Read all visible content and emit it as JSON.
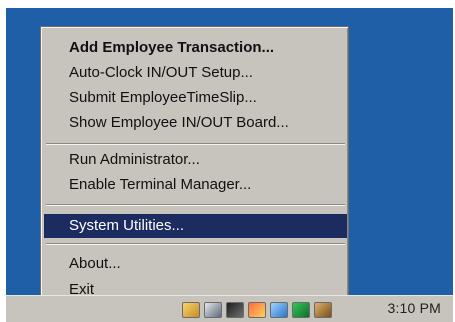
{
  "menu": {
    "items": [
      {
        "label": "Add Employee Transaction...",
        "bold": true,
        "selected": false
      },
      {
        "label": "Auto-Clock IN/OUT Setup...",
        "bold": false,
        "selected": false
      },
      {
        "label": "Submit EmployeeTimeSlip...",
        "bold": false,
        "selected": false
      },
      {
        "label": "Show Employee IN/OUT Board...",
        "bold": false,
        "selected": false
      },
      {
        "label": "Run Administrator...",
        "bold": false,
        "selected": false
      },
      {
        "label": "Enable Terminal Manager...",
        "bold": false,
        "selected": false
      },
      {
        "label": "System Utilities...",
        "bold": false,
        "selected": true
      },
      {
        "label": "About...",
        "bold": false,
        "selected": false
      },
      {
        "label": "Exit",
        "bold": false,
        "selected": false
      }
    ]
  },
  "taskbar": {
    "time": "3:10 PM",
    "tray_icons": [
      "pencil-icon",
      "monitor-icon",
      "camera-icon",
      "spark-icon",
      "network-icon",
      "grid-icon",
      "package-icon"
    ]
  },
  "colors": {
    "desktop": "#1f5fa8",
    "menu_bg": "#c7c3bd",
    "selection": "#1c2c61"
  }
}
